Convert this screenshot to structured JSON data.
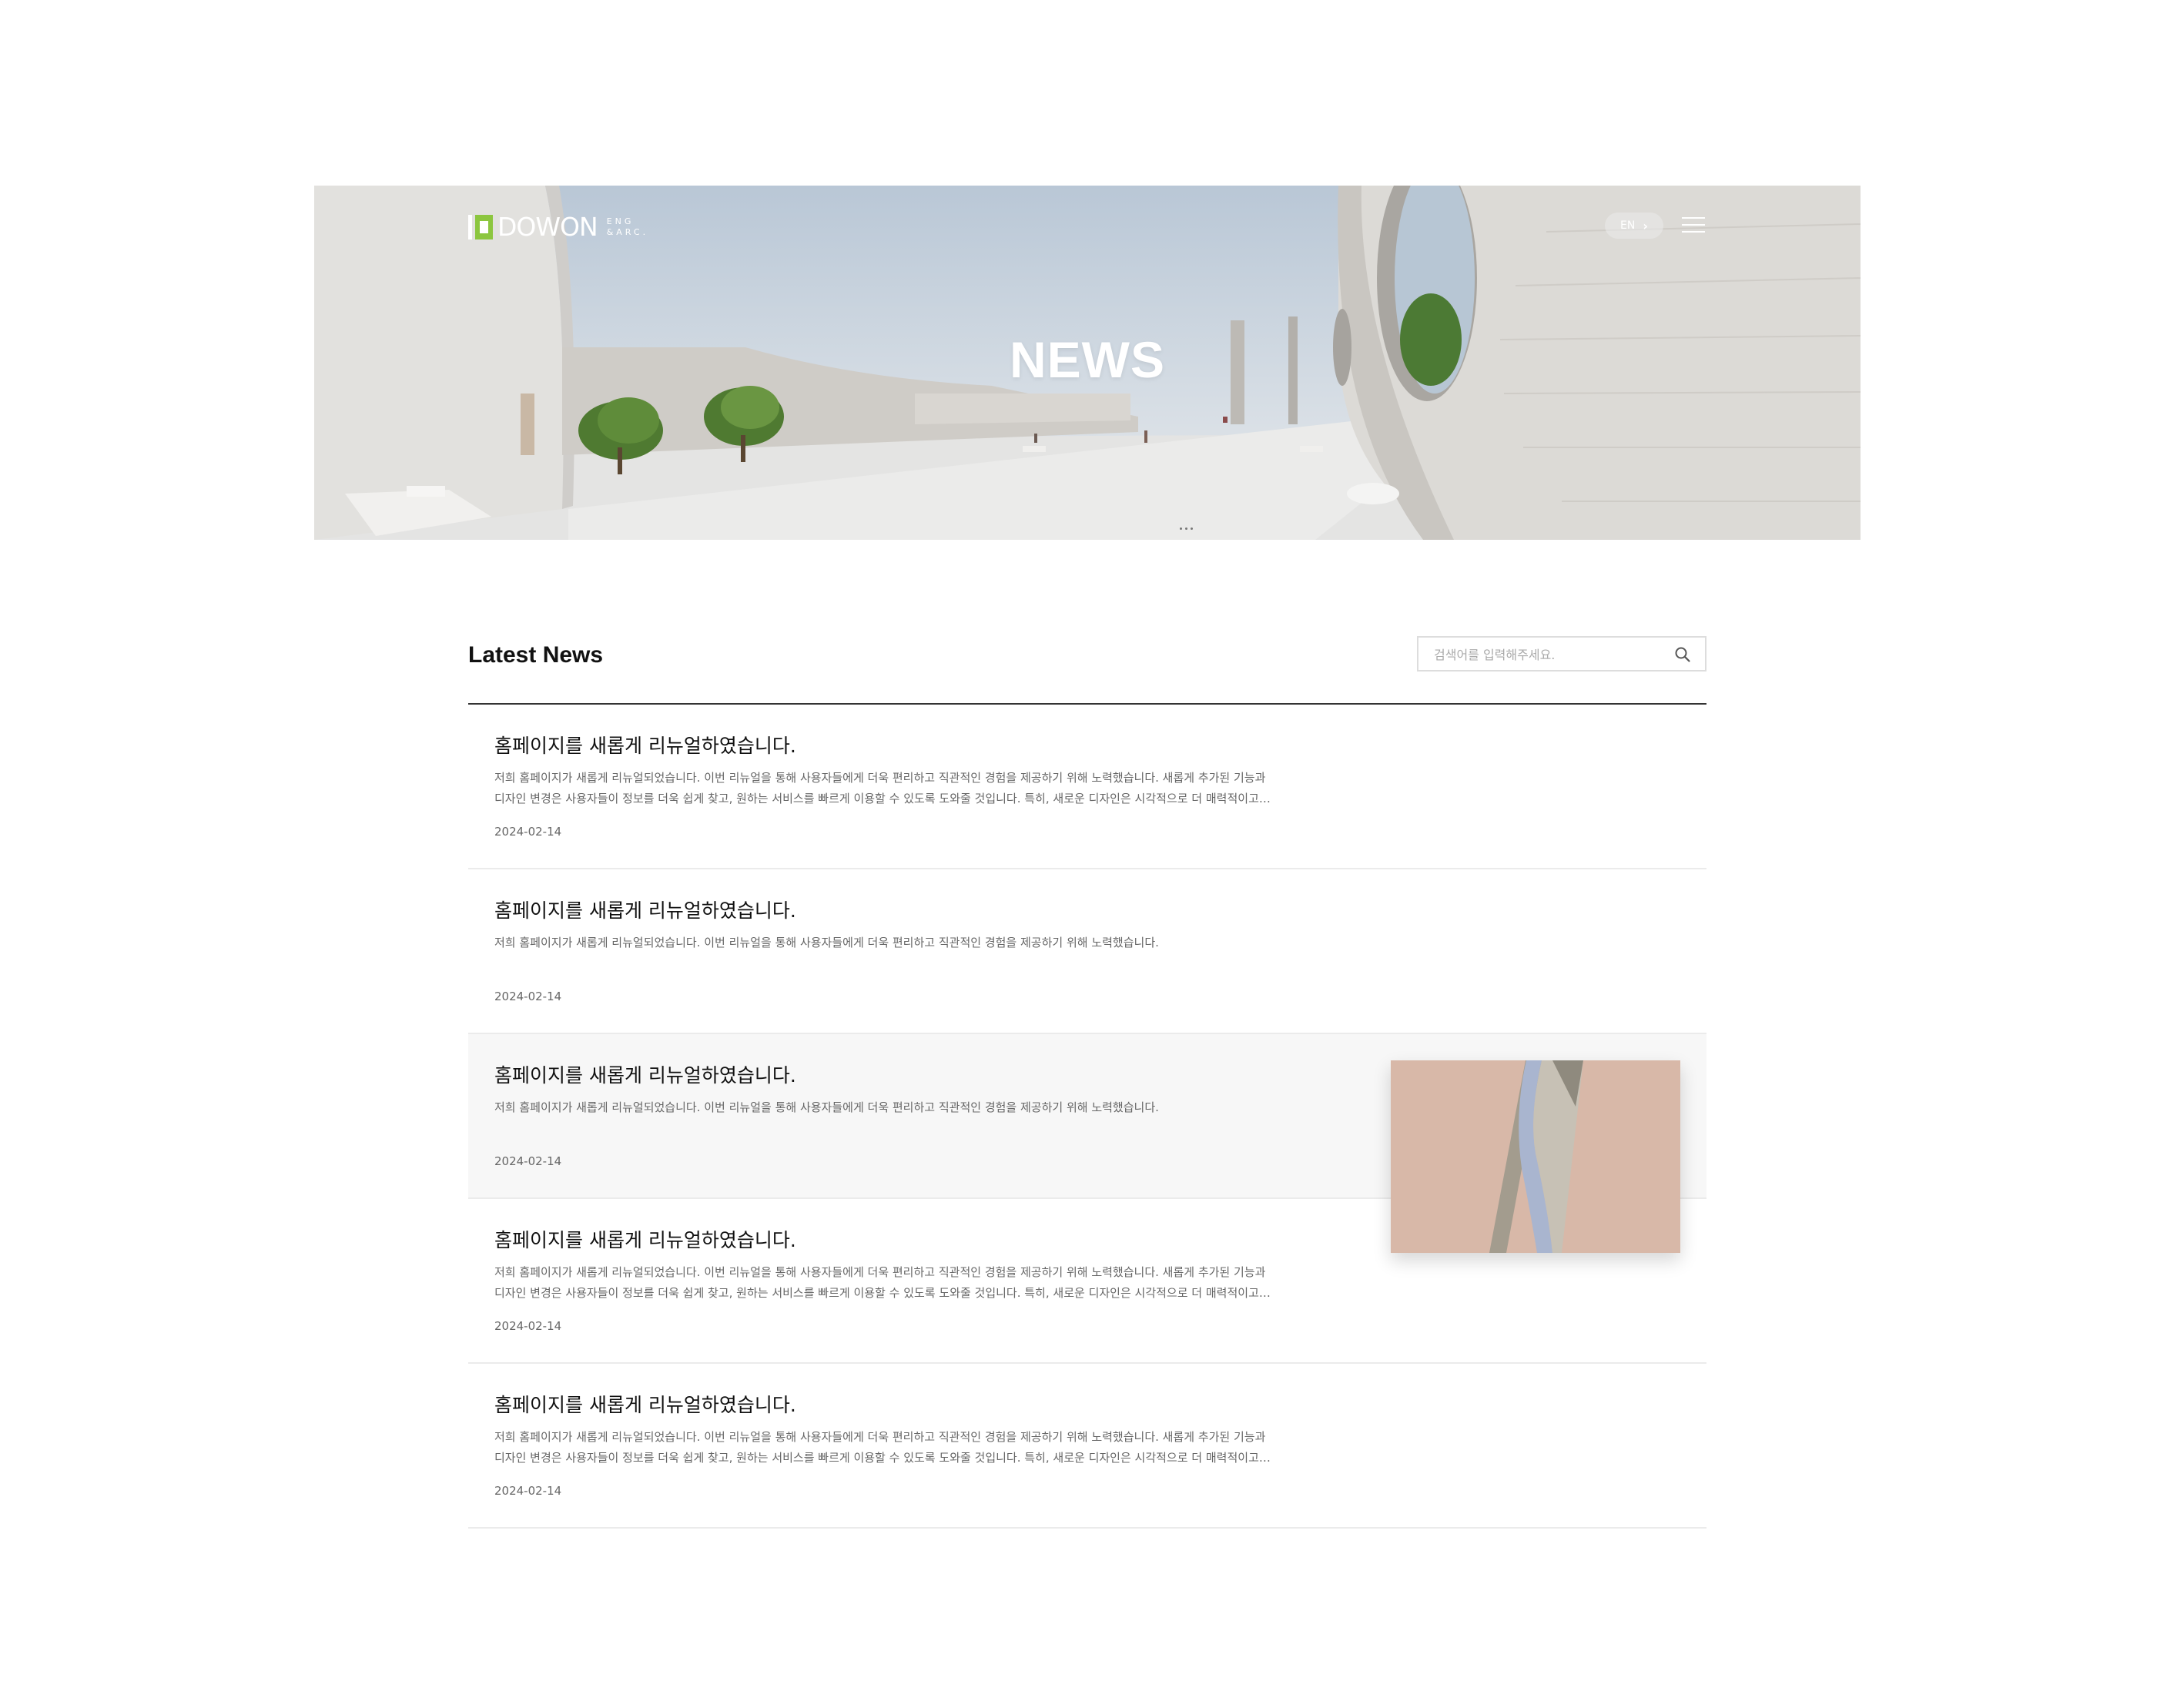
{
  "header": {
    "logo_text": "DOWON",
    "logo_sub_line1": "ENG",
    "logo_sub_line2": "&ARC.",
    "lang_label": "EN",
    "hero_title": "NEWS"
  },
  "list": {
    "section_title": "Latest News",
    "search_placeholder": "검색어를 입력해주세요.",
    "items": [
      {
        "title": "홈페이지를 새롭게 리뉴얼하였습니다.",
        "line1": "저희 홈페이지가 새롭게 리뉴얼되었습니다. 이번 리뉴얼을 통해 사용자들에게 더욱 편리하고 직관적인 경험을 제공하기 위해 노력했습니다. 새롭게 추가된 기능과",
        "line2": "디자인 변경은 사용자들이 정보를 더욱 쉽게 찾고, 원하는 서비스를 빠르게 이용할 수 있도록 도와줄 것입니다. 특히, 새로운 디자인은 시각적으로 더 매력적이고 ...",
        "date": "2024-02-14"
      },
      {
        "title": "홈페이지를 새롭게 리뉴얼하였습니다.",
        "line1": "저희 홈페이지가 새롭게 리뉴얼되었습니다. 이번 리뉴얼을 통해 사용자들에게 더욱 편리하고 직관적인 경험을 제공하기 위해 노력했습니다.",
        "line2": "",
        "date": "2024-02-14"
      },
      {
        "title": "홈페이지를 새롭게 리뉴얼하였습니다.",
        "line1": "저희 홈페이지가 새롭게 리뉴얼되었습니다. 이번 리뉴얼을 통해 사용자들에게 더욱 편리하고 직관적인 경험을 제공하기 위해 노력했습니다.",
        "line2": "",
        "date": "2024-02-14"
      },
      {
        "title": "홈페이지를 새롭게 리뉴얼하였습니다.",
        "line1": "저희 홈페이지가 새롭게 리뉴얼되었습니다. 이번 리뉴얼을 통해 사용자들에게 더욱 편리하고 직관적인 경험을 제공하기 위해 노력했습니다. 새롭게 추가된 기능과",
        "line2": "디자인 변경은 사용자들이 정보를 더욱 쉽게 찾고, 원하는 서비스를 빠르게 이용할 수 있도록 도와줄 것입니다. 특히, 새로운 디자인은 시각적으로 더 매력적이고 ...",
        "date": "2024-02-14"
      },
      {
        "title": "홈페이지를 새롭게 리뉴얼하였습니다.",
        "line1": "저희 홈페이지가 새롭게 리뉴얼되었습니다. 이번 리뉴얼을 통해 사용자들에게 더욱 편리하고 직관적인 경험을 제공하기 위해 노력했습니다. 새롭게 추가된 기능과",
        "line2": "디자인 변경은 사용자들이 정보를 더욱 쉽게 찾고, 원하는 서비스를 빠르게 이용할 수 있도록 도와줄 것입니다. 특히, 새로운 디자인은 시각적으로 더 매력적이고 ...",
        "date": "2024-02-14"
      }
    ]
  },
  "colors": {
    "brand_green": "#8cc63f",
    "divider_dark": "#333333",
    "hover_bg": "#f7f7f7"
  },
  "icons": {
    "search": "search-icon",
    "menu": "hamburger-menu-icon",
    "lang_arrow": "chevron-right-icon"
  }
}
